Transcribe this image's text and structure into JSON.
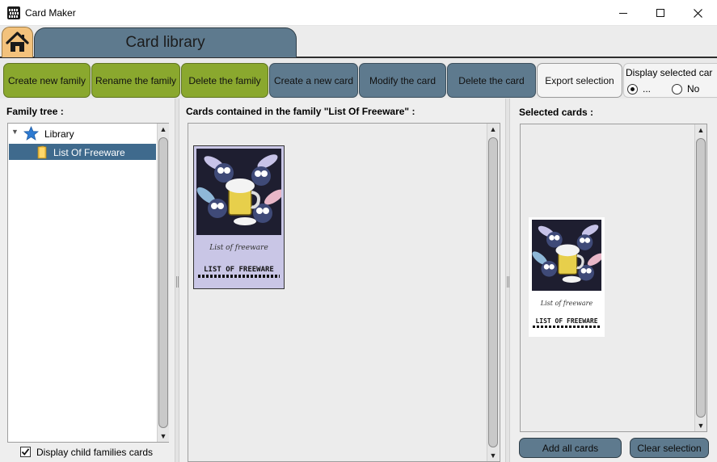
{
  "window": {
    "title": "Card Maker",
    "minimize_glyph": "—",
    "maximize_glyph": "☐",
    "close_glyph": "✕"
  },
  "tabs": {
    "home_icon": "home-icon",
    "library_label": "Card library"
  },
  "toolbar": {
    "create_family": "Create new family",
    "rename_family": "Rename the family",
    "delete_family": "Delete the family",
    "create_card": "Create a new card",
    "modify_card": "Modify the card",
    "delete_card": "Delete the card",
    "export_selection": "Export selection",
    "display_selected": {
      "label": "Display selected car",
      "option_yes": "...",
      "option_no": "No",
      "selected": "..."
    }
  },
  "family_tree": {
    "title": "Family tree :",
    "root": {
      "label": "Library",
      "icon": "star-icon",
      "expanded": true
    },
    "children": [
      {
        "label": "List Of Freeware",
        "icon": "folder-icon",
        "selected": true
      }
    ],
    "display_child_label": "Display child families cards",
    "display_child_checked": true
  },
  "cards_panel": {
    "title": "Cards contained in the family \"List Of Freeware\" :",
    "card": {
      "caption": "List of freeware",
      "name": "LIST OF FREEWARE"
    }
  },
  "selected_panel": {
    "title": "Selected cards :",
    "card": {
      "caption": "List of freeware",
      "name": "LIST OF FREEWARE"
    },
    "add_all_label": "Add all cards",
    "clear_label": "Clear selection"
  },
  "colors": {
    "green_button": "#8aa82e",
    "blue_button": "#5e7a8e",
    "tree_selection": "#3f6a8d",
    "home_tab": "#f3c27c"
  }
}
